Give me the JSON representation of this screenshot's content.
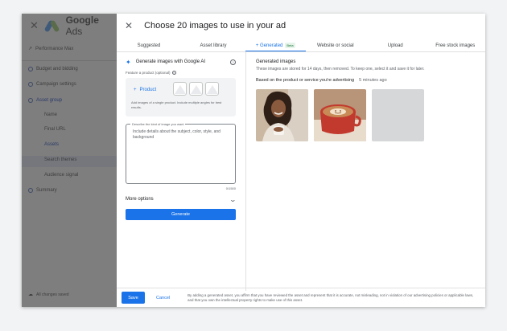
{
  "background_app": {
    "close_icon": "close-icon",
    "app_name_bold": "Google",
    "app_name_rest": " Ads",
    "sidebar": [
      {
        "label": "Performance Max",
        "icon": "chart-icon",
        "type": "top"
      },
      {
        "label": "Budget and bidding",
        "icon": "check-circle-icon",
        "type": "top"
      },
      {
        "label": "Campaign settings",
        "icon": "check-circle-icon",
        "type": "top"
      },
      {
        "label": "Asset group",
        "icon": "check-circle-icon",
        "type": "top"
      },
      {
        "label": "Name",
        "type": "sub"
      },
      {
        "label": "Final URL",
        "type": "sub"
      },
      {
        "label": "Assets",
        "type": "sub"
      },
      {
        "label": "Search themes",
        "type": "sub"
      },
      {
        "label": "Audience signal",
        "type": "sub"
      },
      {
        "label": "Summary",
        "icon": "circle-icon",
        "type": "top"
      }
    ],
    "footer_status": "All changes saved"
  },
  "modal": {
    "title": "Choose 20 images to use in your ad",
    "tabs_left": [
      "Suggested",
      "Asset library"
    ],
    "tabs_right": [
      {
        "label": "+ Generated",
        "badge": "Beta",
        "active": true
      },
      {
        "label": "Website or social"
      },
      {
        "label": "Upload"
      },
      {
        "label": "Free stock images"
      }
    ],
    "left_panel": {
      "heading": "Generate images with Google AI",
      "feature_label": "Feature a product (optional)",
      "product_button": "Product",
      "product_hint": "Add images of a single product. Include multiple angles for best results.",
      "describe_legend": "Describe the kind of image you want",
      "describe_placeholder": "Include details about the subject, color, style, and background",
      "counter": "0/1500",
      "more_options": "More options",
      "generate_button": "Generate"
    },
    "right_panel": {
      "title": "Generated images",
      "subtitle": "These images are stored for 14 days, then removed. To keep one, select it and save it for later.",
      "section_label": "Based on the product or service you're advertising",
      "section_time": "5 minutes ago",
      "thumbnails": [
        "woman-drinking-coffee-image",
        "latte-art-mug-image",
        "placeholder-image"
      ]
    },
    "footer": {
      "save": "Save",
      "cancel": "Cancel",
      "legal": "By adding a generated asset, you affirm that you have reviewed the asset and represent that it is accurate, not misleading, not in violation of our advertising policies or applicable laws, and that you own the intellectual property rights to make use of this asset."
    }
  },
  "colors": {
    "accent": "#1a73e8",
    "overlay_sidebar": "#7e7e7e"
  }
}
